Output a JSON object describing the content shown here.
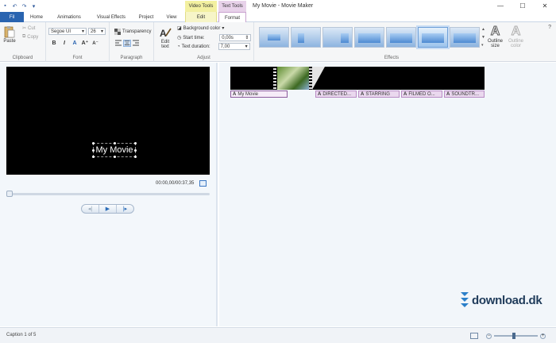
{
  "window": {
    "title": "My Movie - Movie Maker",
    "context_video_tools": "Video Tools",
    "context_text_tools": "Text Tools"
  },
  "tabs": [
    {
      "label": "Fil"
    },
    {
      "label": "Home"
    },
    {
      "label": "Animations"
    },
    {
      "label": "Visual Effects"
    },
    {
      "label": "Project"
    },
    {
      "label": "View"
    },
    {
      "label": "Edit"
    },
    {
      "label": "Format"
    }
  ],
  "clipboard": {
    "paste": "Paste",
    "cut": "Cut",
    "copy": "Copy",
    "label": "Clipboard"
  },
  "font": {
    "family": "Segoe UI",
    "size": "26",
    "label": "Font"
  },
  "paragraph": {
    "transparency": "Transparency",
    "label": "Paragraph"
  },
  "adjust": {
    "edit_text": [
      "Edit",
      "text"
    ],
    "background_color": "Background color",
    "start_time_label": "Start time:",
    "start_time_value": "0,00s",
    "text_duration_label": "Text duration:",
    "text_duration_value": "7,00",
    "label": "Adjust"
  },
  "effects": {
    "label": "Effects",
    "outline_size": [
      "Outline",
      "size"
    ],
    "outline_color": [
      "Outline",
      "color"
    ]
  },
  "preview": {
    "caption_text": "My Movie",
    "timecode": "00:00,00/00:37,35"
  },
  "storyboard": {
    "captions": [
      "My Movie",
      "DIRECTED...",
      "STARRING",
      "FILMED O...",
      "SOUNDTR..."
    ]
  },
  "watermark": "download.dk",
  "status": {
    "caption": "Caption 1 of 5"
  },
  "zoom_level": 0.45,
  "colors": {
    "file_tab": "#2a64b0",
    "video_tools": "#f3f0a0",
    "text_tools": "#e8d2ea"
  }
}
